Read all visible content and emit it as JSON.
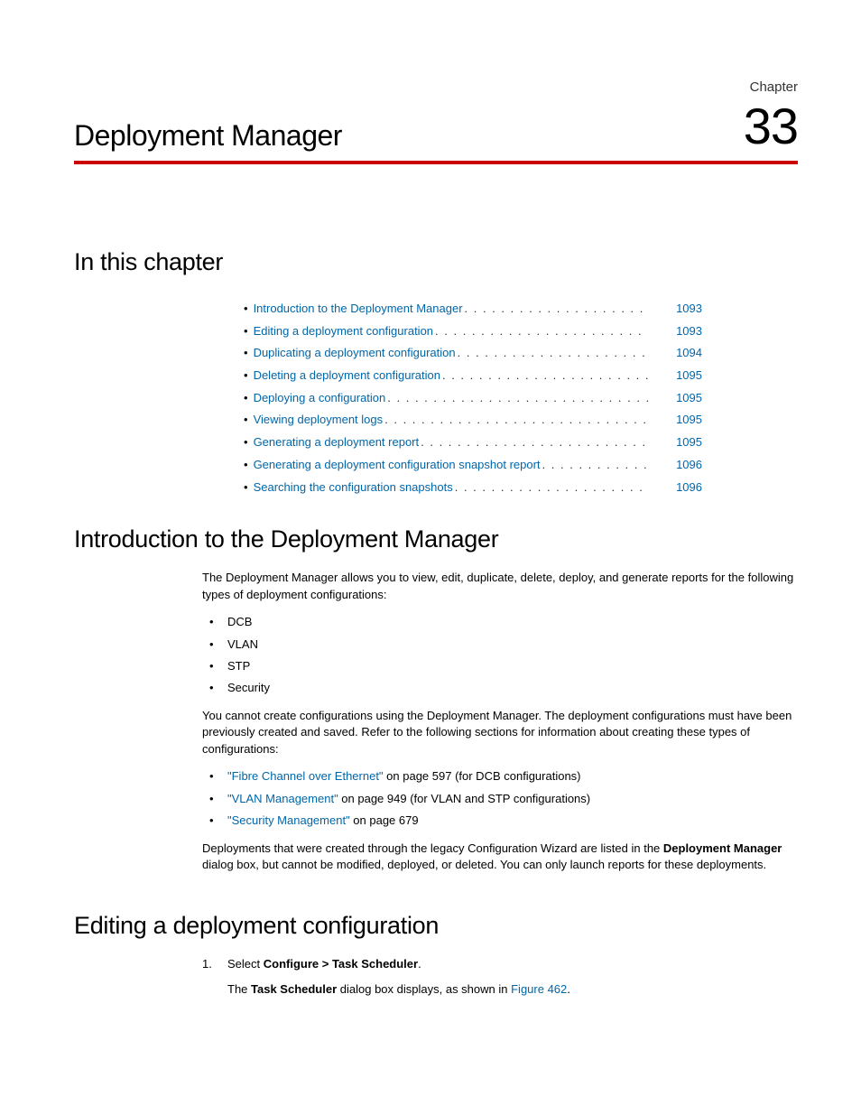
{
  "chapter": {
    "label": "Chapter",
    "number": "33",
    "title": "Deployment Manager"
  },
  "sections": {
    "in_this_chapter": "In this chapter",
    "intro_heading": "Introduction to the Deployment Manager",
    "editing_heading": "Editing a deployment configuration"
  },
  "toc": [
    {
      "label": "Introduction to the Deployment Manager",
      "page": "1093"
    },
    {
      "label": "Editing a deployment configuration",
      "page": "1093"
    },
    {
      "label": "Duplicating a deployment configuration",
      "page": "1094"
    },
    {
      "label": "Deleting a deployment configuration",
      "page": "1095"
    },
    {
      "label": "Deploying a configuration",
      "page": "1095"
    },
    {
      "label": "Viewing deployment logs",
      "page": "1095"
    },
    {
      "label": "Generating a deployment report",
      "page": "1095"
    },
    {
      "label": "Generating a deployment configuration snapshot report",
      "page": "1096"
    },
    {
      "label": "Searching the configuration snapshots",
      "page": "1096"
    }
  ],
  "intro": {
    "p1": "The Deployment Manager allows you to view, edit, duplicate, delete, deploy, and generate reports for the following types of deployment configurations:",
    "types": [
      "DCB",
      "VLAN",
      "STP",
      "Security"
    ],
    "p2": "You cannot create configurations using the Deployment Manager. The deployment configurations must have been previously created and saved. Refer to the following sections for information about creating these types of configurations:",
    "refs": [
      {
        "link": "\"Fibre Channel over Ethernet\"",
        "rest": " on page 597 (for DCB configurations)"
      },
      {
        "link": "\"VLAN Management\"",
        "rest": " on page 949 (for VLAN and STP configurations)"
      },
      {
        "link": "\"Security Management\"",
        "rest": " on page 679"
      }
    ],
    "p3a": "Deployments that were created through the legacy Configuration Wizard are listed in the ",
    "p3bold": "Deployment Manager",
    "p3b": " dialog box, but cannot be modified, deployed, or deleted. You can only launch reports for these deployments."
  },
  "editing": {
    "step1_a": "Select ",
    "step1_bold": "Configure > Task Scheduler",
    "step1_b": ".",
    "step1_body_a": "The ",
    "step1_body_bold": "Task Scheduler",
    "step1_body_b": " dialog box displays, as shown in ",
    "step1_body_link": "Figure 462",
    "step1_body_c": "."
  }
}
